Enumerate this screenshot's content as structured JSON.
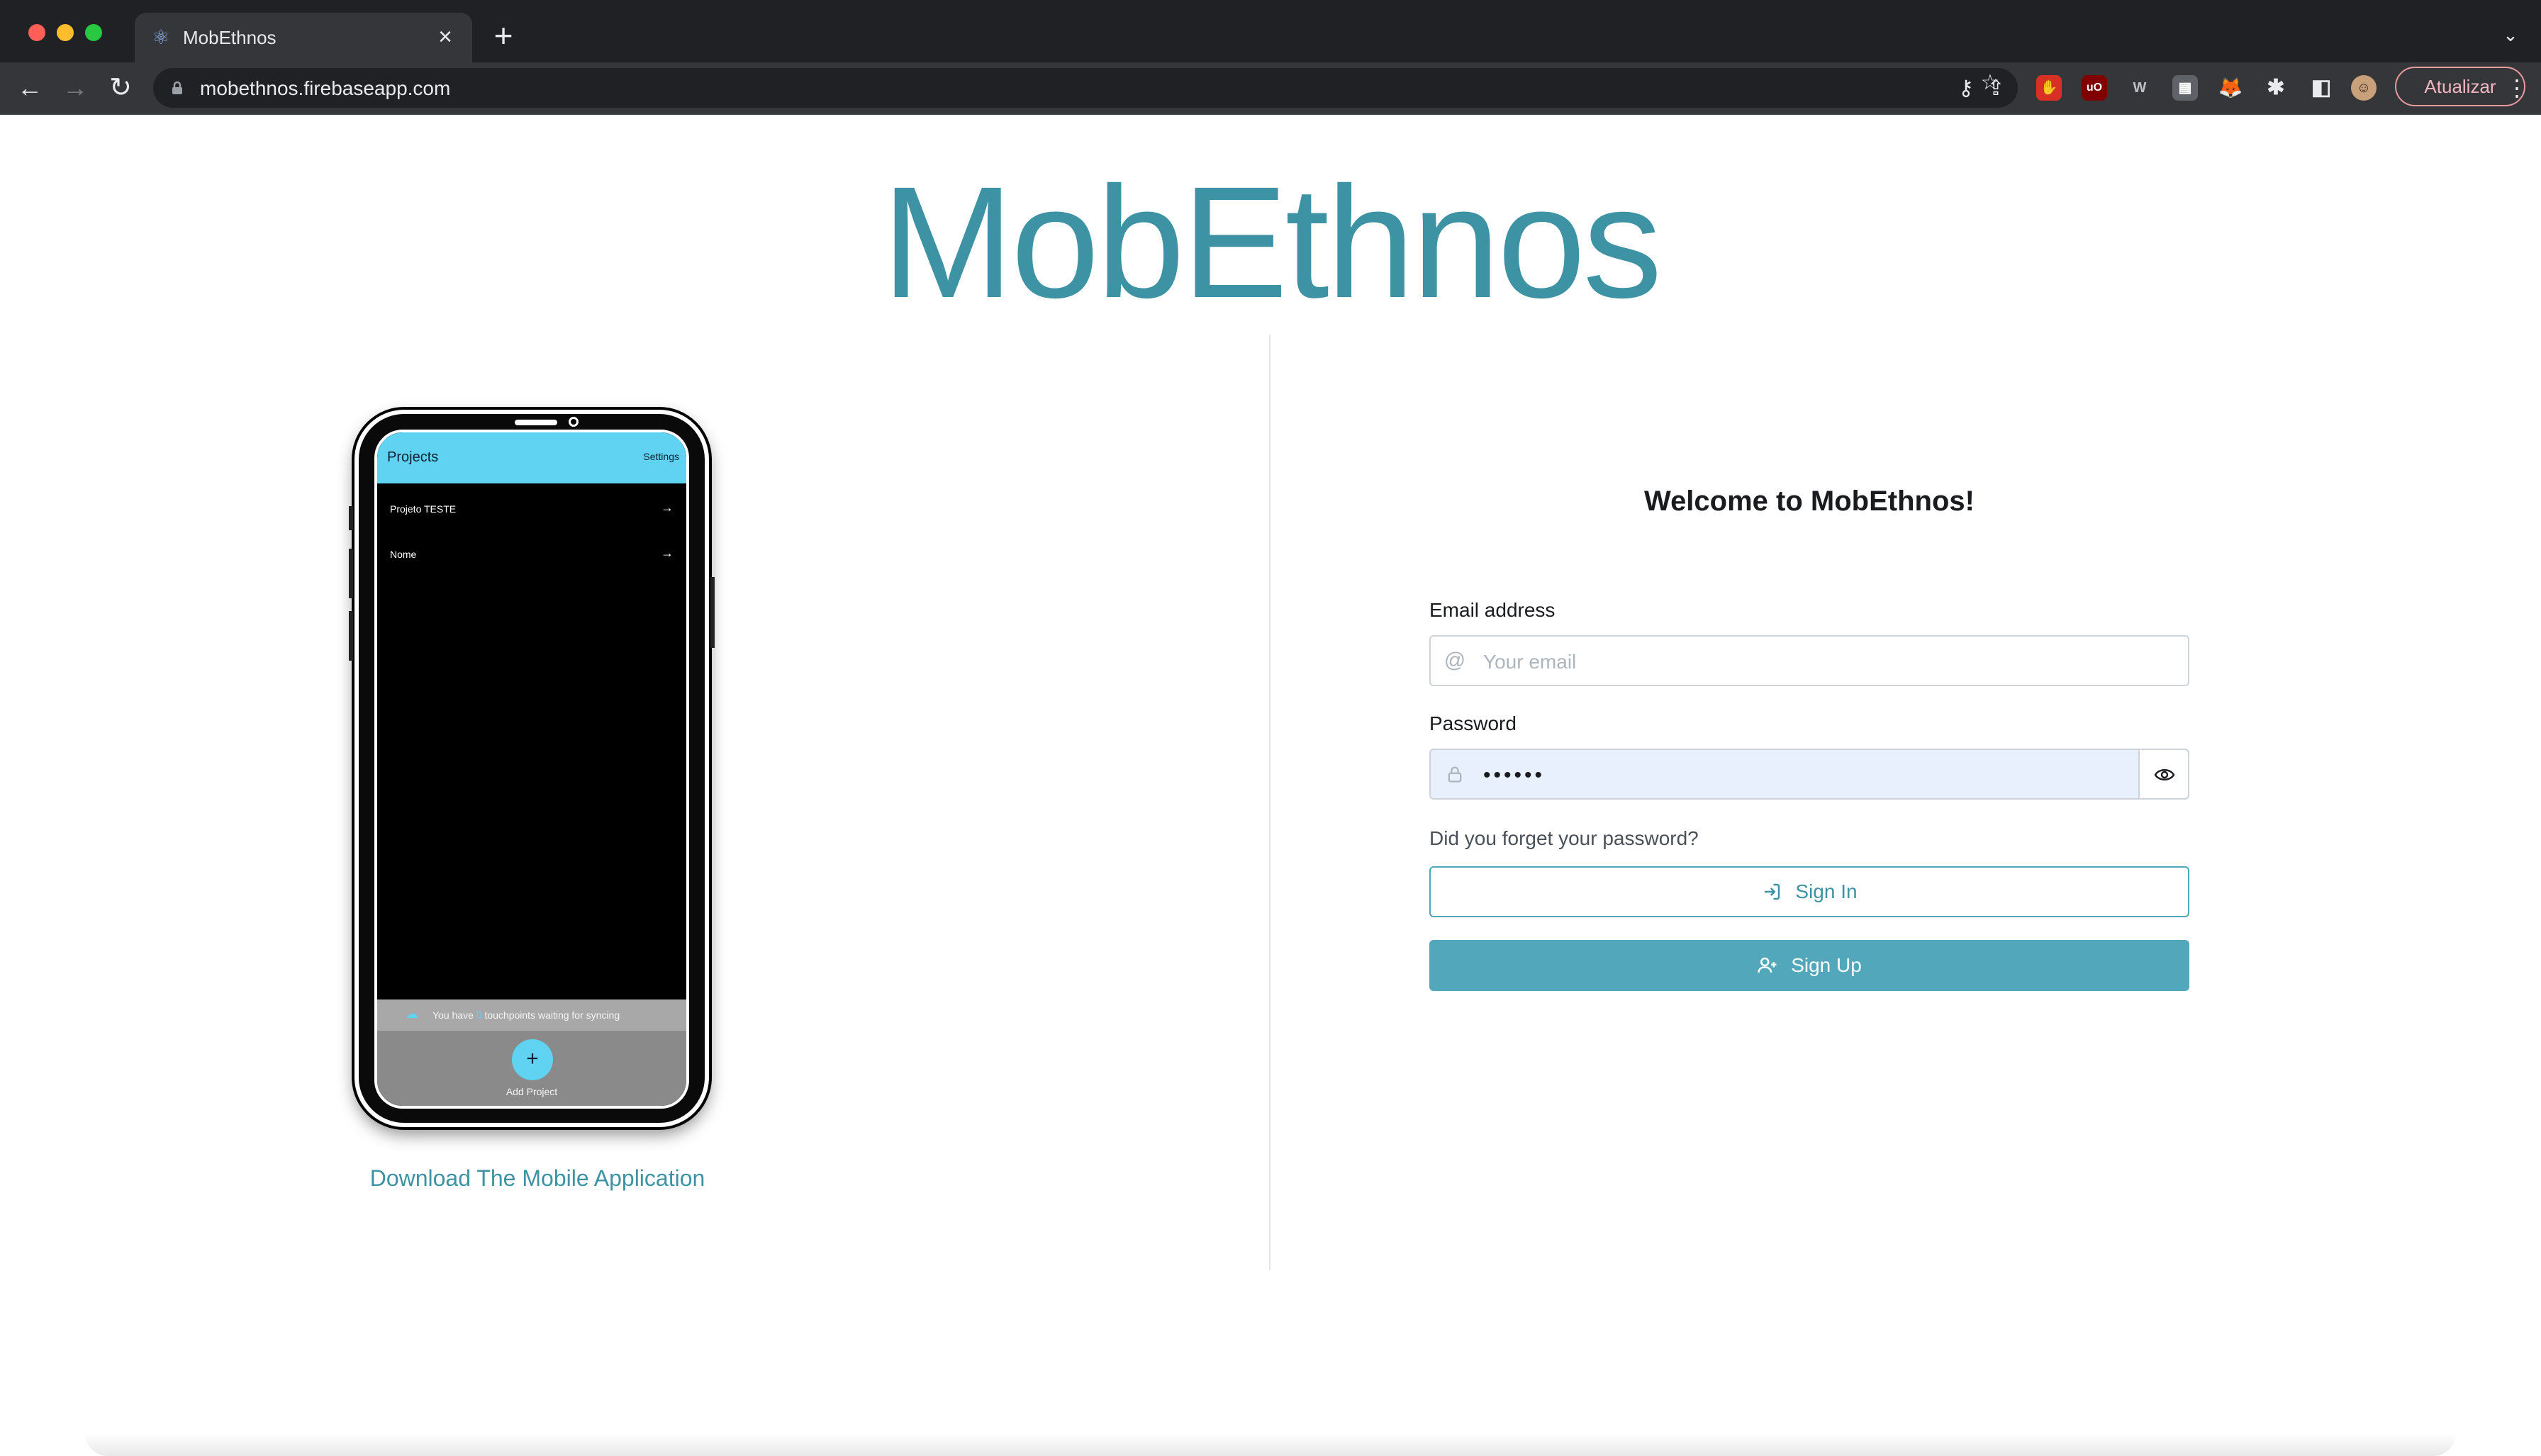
{
  "browser": {
    "tab_title": "MobEthnos",
    "url": "mobethnos.firebaseapp.com",
    "update_label": "Atualizar",
    "icons": {
      "back": "arrow-left-icon",
      "forward": "arrow-right-icon",
      "reload": "reload-icon",
      "lock": "lock-icon",
      "key": "key-icon",
      "share": "share-icon",
      "star": "star-icon"
    }
  },
  "page": {
    "logo": "MobEthnos",
    "download_link": "Download The Mobile Application",
    "colors": {
      "brand": "#3d93a3",
      "button": "#52a7bb",
      "app_header": "#5fd3f1"
    }
  },
  "phone": {
    "header_title": "Projects",
    "header_settings": "Settings",
    "projects": [
      {
        "name": "Projeto TESTE"
      },
      {
        "name": "Nome"
      }
    ],
    "sync_text_before": "You have",
    "sync_count": "0",
    "sync_text_after": "touchpoints waiting for syncing",
    "add_label": "Add Project",
    "add_symbol": "+"
  },
  "form": {
    "welcome": "Welcome to MobEthnos!",
    "email_label": "Email address",
    "email_placeholder": "Your email",
    "password_label": "Password",
    "password_value": "••••••",
    "forgot": "Did you forget your password?",
    "signin_label": "Sign In",
    "signup_label": "Sign Up"
  }
}
